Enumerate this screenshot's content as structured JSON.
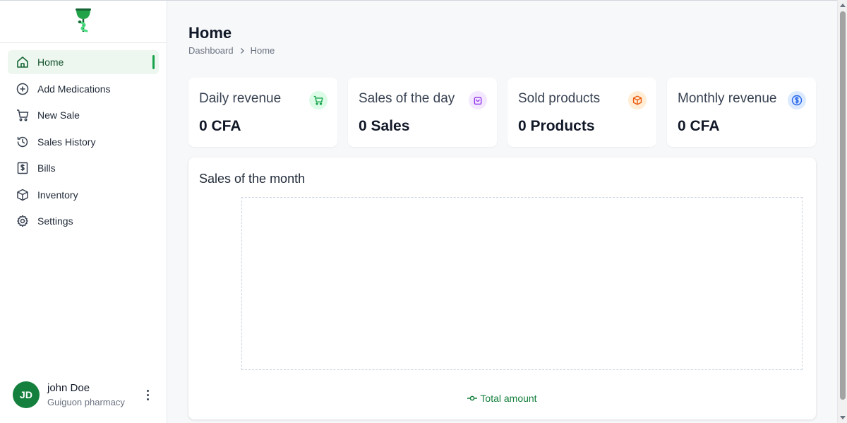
{
  "sidebar": {
    "items": [
      {
        "label": "Home",
        "icon": "home-icon",
        "active": true
      },
      {
        "label": "Add Medications",
        "icon": "plus-circle-icon"
      },
      {
        "label": "New Sale",
        "icon": "cart-icon"
      },
      {
        "label": "Sales History",
        "icon": "history-icon"
      },
      {
        "label": "Bills",
        "icon": "bill-icon"
      },
      {
        "label": "Inventory",
        "icon": "box-icon"
      },
      {
        "label": "Settings",
        "icon": "gear-icon"
      }
    ],
    "user": {
      "initials": "JD",
      "name": "john Doe",
      "subtitle": "Guiguon pharmacy"
    }
  },
  "header": {
    "title": "Home",
    "breadcrumb": [
      "Dashboard",
      "Home"
    ]
  },
  "cards": [
    {
      "title": "Daily revenue",
      "value": "0 CFA",
      "icon": "cart-icon",
      "accent": "#16a34a",
      "bg": "#dcfce7"
    },
    {
      "title": "Sales of the day",
      "value": "0 Sales",
      "icon": "shopping-bag-icon",
      "accent": "#9333ea",
      "bg": "#f3e8ff"
    },
    {
      "title": "Sold products",
      "value": "0 Products",
      "icon": "package-icon",
      "accent": "#ea580c",
      "bg": "#ffedd5"
    },
    {
      "title": "Monthly revenue",
      "value": "0 CFA",
      "icon": "dollar-icon",
      "accent": "#2563eb",
      "bg": "#dbeafe"
    }
  ],
  "chart": {
    "title": "Sales of the month",
    "legend": "Total amount",
    "legend_color": "#15803d"
  },
  "chart_data": {
    "type": "line",
    "title": "Sales of the month",
    "series": [
      {
        "name": "Total amount",
        "values": []
      }
    ],
    "x": [],
    "grid": false,
    "legend_position": "bottom"
  },
  "colors": {
    "brand": "#16a34a",
    "active_bg": "#edf7ef"
  }
}
